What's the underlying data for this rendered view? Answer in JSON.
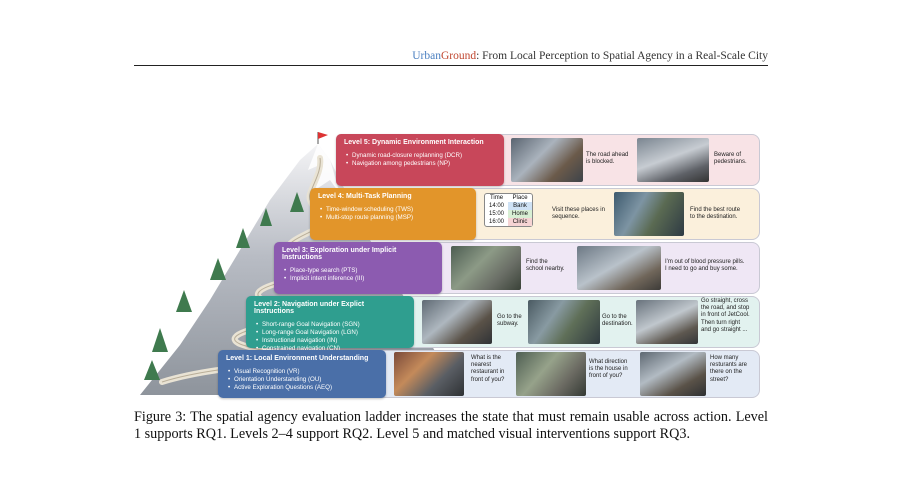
{
  "header": {
    "brand_part1": "Urban",
    "brand_part2": "Ground",
    "title_rest": ": From Local Perception to Spatial Agency in a Real-Scale City"
  },
  "levels": [
    {
      "title": "Level 5: Dynamic Environment Interaction",
      "items": [
        "Dynamic road-closure replanning (DCR)",
        "Navigation among pedestrians (NP)"
      ],
      "color": "#c8475a",
      "row_bg": "#f8e3e6",
      "examples": [
        "The road ahead\nis blocked.",
        "Beware of\npedestrians."
      ]
    },
    {
      "title": "Level 4: Multi-Task Planning",
      "items": [
        "Time-window scheduling (TWS)",
        "Multi-stop route planning (MSP)"
      ],
      "color": "#e2952a",
      "row_bg": "#fbf0dc",
      "examples": [
        "Visit these places in\nsequence.",
        "Find the best route\nto the destination."
      ]
    },
    {
      "title": "Level 3: Exploration under Implicit Instructions",
      "items": [
        "Place-type search (PTS)",
        "Implicit intent inference (III)"
      ],
      "color": "#8c5bb0",
      "row_bg": "#efe7f5",
      "examples": [
        "Find the\nschool nearby.",
        "I'm out of blood pressure pills.\nI need to go and buy some."
      ]
    },
    {
      "title": "Level 2: Navigation under Explict Instructions",
      "items": [
        "Short-range Goal Navigation (SGN)",
        "Long-range Goal Navigation (LGN)",
        "Instructional navigation (IN)",
        "Constrained navigation (CN)"
      ],
      "color": "#2f9e8f",
      "row_bg": "#e2f2ef",
      "examples": [
        "Go to the\nsubway.",
        "Go to the\ndestination.",
        "Go straight, cross\nthe road, and stop\nin front of JetCool.\nThen turn right\nand go straight ..."
      ]
    },
    {
      "title": "Level 1: Local Environment Understanding",
      "items": [
        "Visual Recognition (VR)",
        "Orientation Understanding (OU)",
        "Active Exploration Questions (AEQ)"
      ],
      "color": "#4a6fa8",
      "row_bg": "#e3eaf5",
      "examples": [
        "What is the\nnearest\nrestaurant in\nfront of you?",
        "What direction\nis the house in\nfront of you?",
        "How many\nresturants are\nthere on the\nstreet?"
      ]
    }
  ],
  "schedule": {
    "headers": [
      "Time",
      "Place"
    ],
    "rows": [
      [
        "14:00",
        "Bank"
      ],
      [
        "15:00",
        "Home"
      ],
      [
        "16:00",
        "Clinic"
      ]
    ]
  },
  "caption": "Figure 3: The spatial agency evaluation ladder increases the state that must remain usable across action. Level 1 supports RQ1. Levels 2–4 support RQ2. Level 5 and matched visual interventions support RQ3."
}
